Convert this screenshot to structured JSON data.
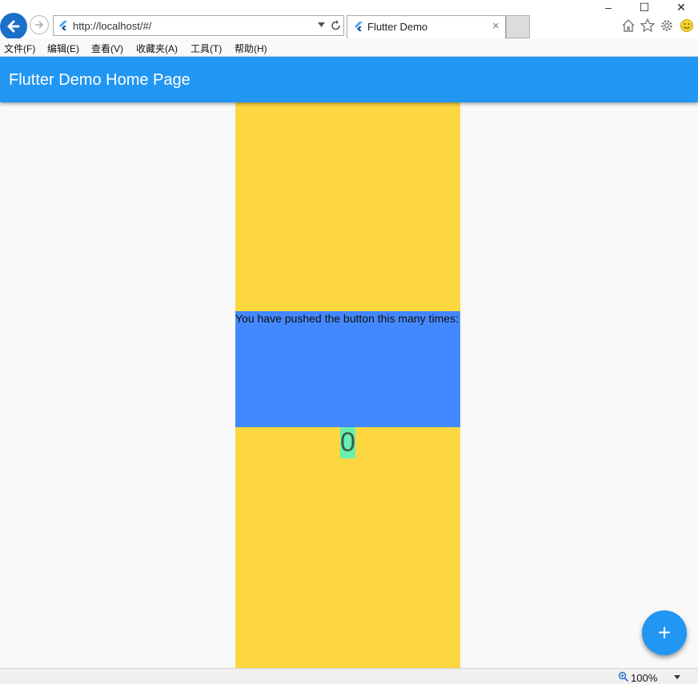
{
  "window": {
    "minimize": "–",
    "maximize": "☐",
    "close": "✕"
  },
  "browser": {
    "address": "http://localhost/#/",
    "tab_title": "Flutter Demo",
    "tab_close": "×"
  },
  "menu": [
    "文件(F)",
    "编辑(E)",
    "查看(V)",
    "收藏夹(A)",
    "工具(T)",
    "帮助(H)"
  ],
  "app": {
    "title": "Flutter Demo Home Page",
    "message": "You have pushed the button this many times:",
    "counter": "0",
    "fab_label": "+"
  },
  "status": {
    "zoom": "100%"
  },
  "colors": {
    "appbar": "#2196f3",
    "column": "#fdd73f",
    "text_box": "#4488ff",
    "counter_bg": "#69f0ae"
  }
}
